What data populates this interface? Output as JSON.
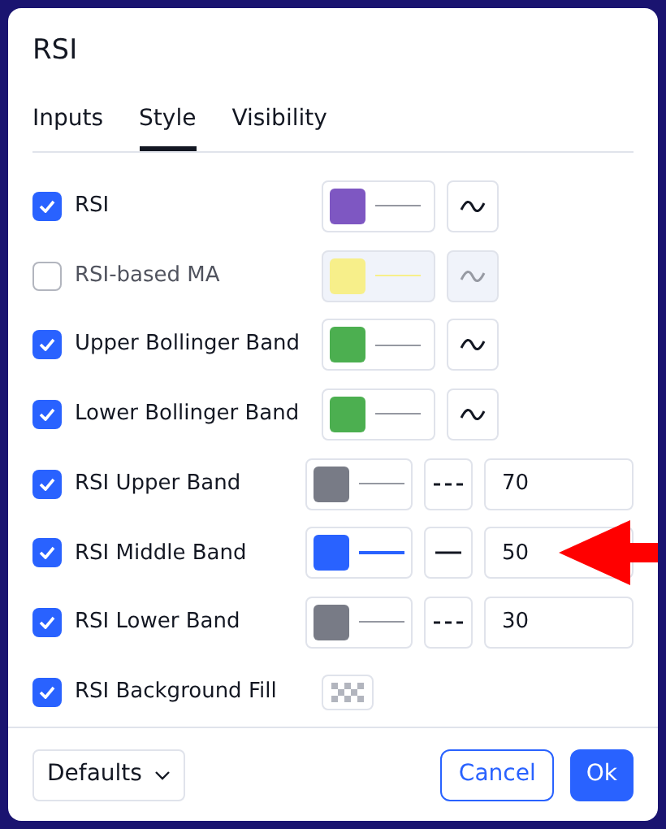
{
  "title": "RSI",
  "tabs": [
    {
      "label": "Inputs",
      "selected": false
    },
    {
      "label": "Style",
      "selected": true
    },
    {
      "label": "Visibility",
      "selected": false
    }
  ],
  "rows": [
    {
      "kind": "plot",
      "label": "RSI",
      "checked": true,
      "color": "#7e57c2"
    },
    {
      "kind": "plot",
      "label": "RSI-based MA",
      "checked": false,
      "color": "#f7ef8a"
    },
    {
      "kind": "plot",
      "label": "Upper Bollinger Band",
      "checked": true,
      "color": "#4caf50"
    },
    {
      "kind": "plot",
      "label": "Lower Bollinger Band",
      "checked": true,
      "color": "#4caf50"
    },
    {
      "kind": "band",
      "label": "RSI Upper Band",
      "checked": true,
      "color": "#787b86",
      "dashed": true,
      "value": "70"
    },
    {
      "kind": "band",
      "label": "RSI Middle Band",
      "checked": true,
      "color": "#2962ff",
      "dashed": false,
      "value": "50",
      "highlighted": true
    },
    {
      "kind": "band",
      "label": "RSI Lower Band",
      "checked": true,
      "color": "#787b86",
      "dashed": true,
      "value": "30"
    },
    {
      "kind": "fill",
      "label": "RSI Background Fill",
      "checked": true
    }
  ],
  "footer": {
    "defaults": "Defaults",
    "cancel": "Cancel",
    "ok": "Ok"
  }
}
